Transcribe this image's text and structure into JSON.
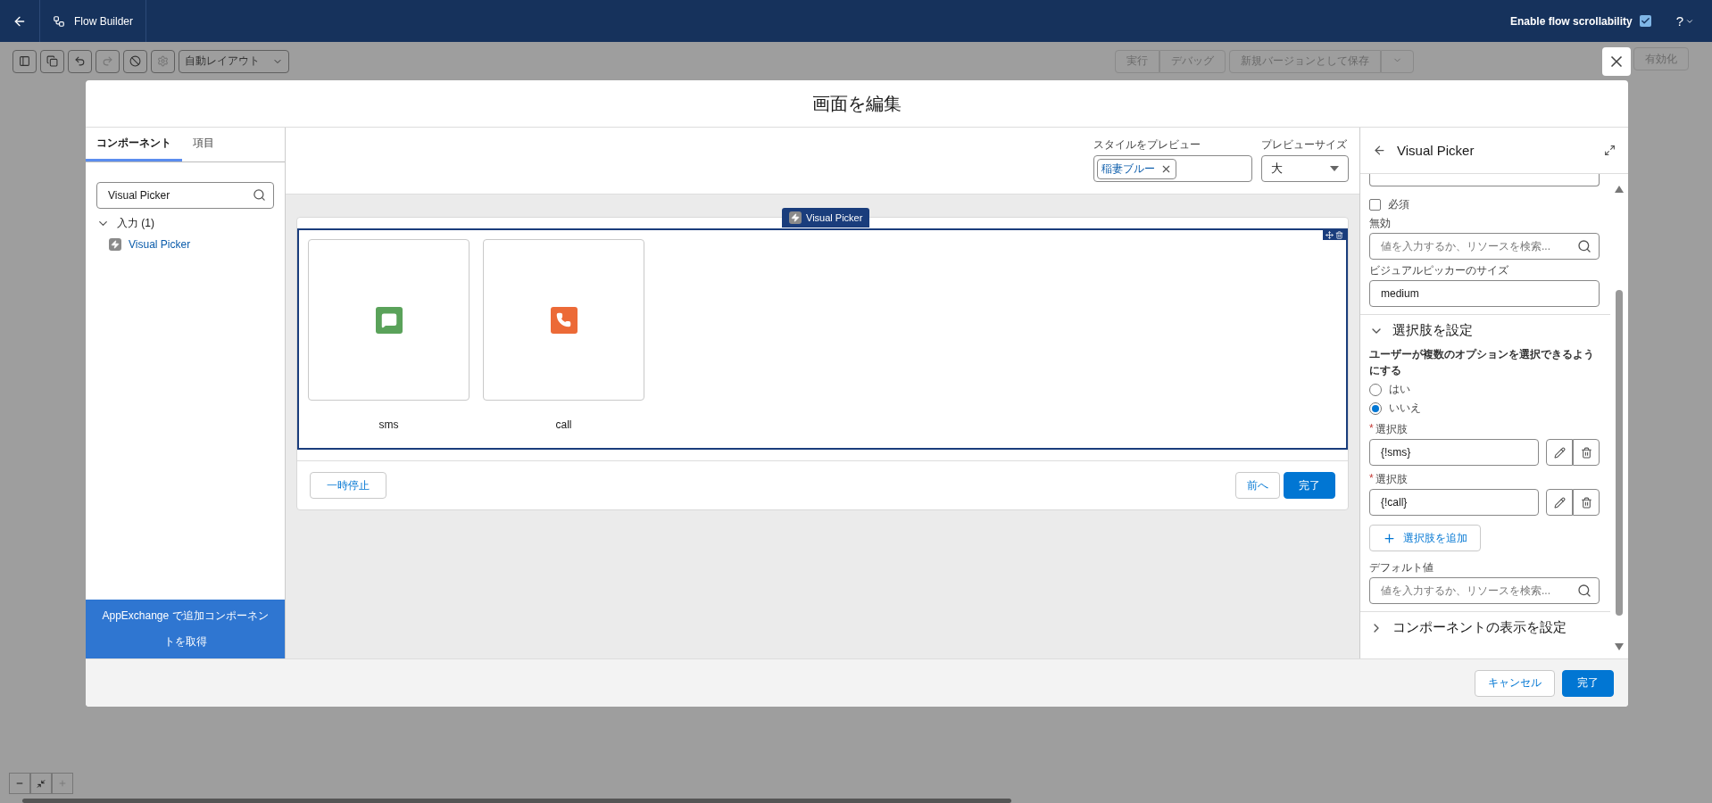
{
  "header": {
    "title": "Flow Builder",
    "scrollability": {
      "label": "Enable flow scrollability",
      "checked": true
    },
    "help": "?"
  },
  "toolbar": {
    "layout": "自動レイアウト",
    "actions": [
      "実行",
      "デバッグ",
      "新規バージョンとして保存"
    ],
    "activate": "有効化"
  },
  "modal": {
    "title": "画面を編集",
    "tabs": [
      {
        "label": "コンポーネント",
        "selected": true
      },
      {
        "label": "項目",
        "selected": false
      }
    ],
    "search": {
      "value": "Visual Picker"
    },
    "tree": [
      {
        "label": "入力 (1)",
        "expanded": true,
        "children": [
          {
            "label": "Visual Picker"
          }
        ]
      }
    ],
    "appexchange": "AppExchange で追加コンポーネントを取得",
    "preview": {
      "style_label": "スタイルをプレビュー",
      "style_pill": "稲妻ブルー",
      "size_label": "プレビューサイズ",
      "size_value": "大"
    },
    "screen": {
      "component_tag": "Visual Picker",
      "options": [
        {
          "kind": "sms",
          "label": "sms",
          "color": "#5aa25a"
        },
        {
          "kind": "call",
          "label": "call",
          "color": "#ec6a37"
        }
      ],
      "pause": "一時停止",
      "back": "前へ",
      "finish": "完了"
    },
    "properties": {
      "title": "Visual Picker",
      "required": {
        "label": "必須",
        "checked": false
      },
      "fields": [
        {
          "kind": "lookup",
          "label": "無効",
          "placeholder": "値を入力するか、リソースを検索..."
        },
        {
          "kind": "text",
          "label": "ビジュアルピッカーのサイズ",
          "value": "medium"
        }
      ],
      "sections": [
        {
          "title": "選択肢を設定",
          "expanded": true,
          "multi_select": {
            "label": "ユーザーが複数のオプションを選択できるようにする",
            "options": [
              {
                "label": "はい",
                "selected": false
              },
              {
                "label": "いいえ",
                "selected": true
              }
            ]
          },
          "choices": [
            {
              "marker": "*",
              "label": "選択肢",
              "value": "{!sms}"
            },
            {
              "marker": "*",
              "label": "選択肢",
              "value": "{!call}"
            }
          ],
          "add_choice": "選択肢を追加",
          "default_value": {
            "label": "デフォルト値",
            "placeholder": "値を入力するか、リソースを検索..."
          }
        },
        {
          "title": "コンポーネントの表示を設定",
          "expanded": false
        }
      ]
    },
    "footer": {
      "cancel": "キャンセル",
      "done": "完了"
    }
  }
}
